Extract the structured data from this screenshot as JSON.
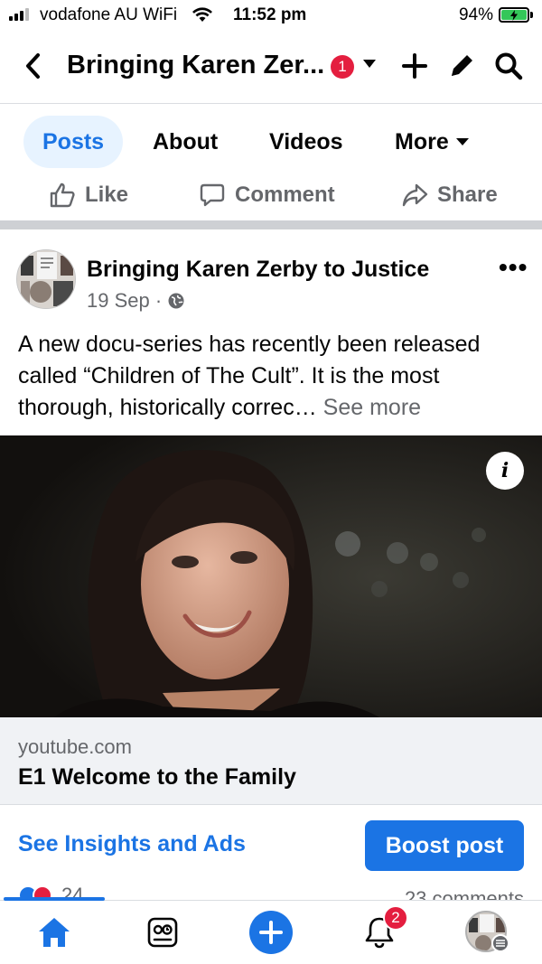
{
  "status_bar": {
    "carrier": "vodafone AU WiFi",
    "time": "11:52 pm",
    "battery_percent": "94%"
  },
  "header": {
    "title": "Bringing Karen Zer...",
    "notification_count": "1",
    "icons": [
      "back-chevron-icon",
      "chevron-down-icon",
      "plus-icon",
      "pencil-icon",
      "search-icon"
    ]
  },
  "tabs": [
    {
      "label": "Posts",
      "active": true
    },
    {
      "label": "About"
    },
    {
      "label": "Videos"
    },
    {
      "label": "More"
    }
  ],
  "actions": {
    "like": "Like",
    "comment": "Comment",
    "share": "Share"
  },
  "post": {
    "author": "Bringing Karen Zerby to Justice",
    "date": "19 Sep ·",
    "audience_icon": "globe-icon",
    "text": "A new docu-series has recently been released called “Children of The Cult”. It is the most thorough, historically correc…",
    "see_more": "See more",
    "link_domain": "youtube.com",
    "link_title": "E1 Welcome to the Family",
    "insights_label": "See Insights and Ads",
    "boost_label": "Boost post",
    "reaction_count": "24",
    "comments_label": "23 comments"
  },
  "bottom_nav": {
    "items": [
      "home-icon",
      "feeds-icon",
      "create-icon",
      "notifications-icon",
      "profile-menu-icon"
    ],
    "notifications_badge": "2"
  },
  "colors": {
    "accent": "#1b74e4",
    "badge": "#e41e3f",
    "secondary_text": "#65676b"
  }
}
